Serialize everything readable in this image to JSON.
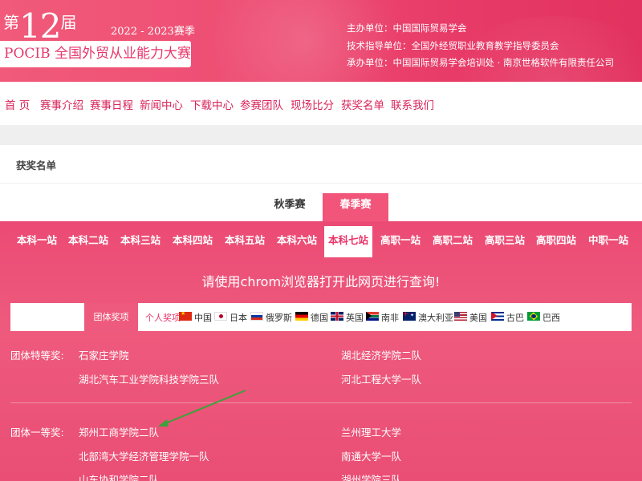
{
  "header": {
    "edition_prefix": "第",
    "edition_number": "12",
    "edition_suffix": "届",
    "season": "2022 - 2023赛季",
    "competition_title": "POCIB 全国外贸从业能力大赛",
    "organizers": [
      "主办单位：中国国际贸易学会",
      "技术指导单位：全国外经贸职业教育教学指导委员会",
      "承办单位：中国国际贸易学会培训处 · 南京世格软件有限责任公司"
    ]
  },
  "nav": {
    "items": [
      "首 页",
      "赛事介绍",
      "赛事日程",
      "新闻中心",
      "下载中心",
      "参赛团队",
      "现场比分",
      "获奖名单",
      "联系我们"
    ]
  },
  "breadcrumb": "获奖名单",
  "season_tabs": {
    "items": [
      "秋季赛",
      "春季赛"
    ],
    "active": "春季赛"
  },
  "stations": {
    "items": [
      "本科一站",
      "本科二站",
      "本科三站",
      "本科四站",
      "本科五站",
      "本科六站",
      "本科七站",
      "高职一站",
      "高职二站",
      "高职三站",
      "高职四站",
      "中职一站"
    ],
    "active": "本科七站"
  },
  "notice": "请使用chrom浏览器打开此网页进行查询!",
  "filter": {
    "team_label": "团体奖项",
    "individual_label": "个人奖项:",
    "countries": [
      {
        "name": "中国",
        "flag": "cn-flag-icon"
      },
      {
        "name": "日本",
        "flag": "jp-flag-icon"
      },
      {
        "name": "俄罗斯",
        "flag": "ru-flag-icon"
      },
      {
        "name": "德国",
        "flag": "de-flag-icon"
      },
      {
        "name": "英国",
        "flag": "gb-flag-icon"
      },
      {
        "name": "南非",
        "flag": "za-flag-icon"
      },
      {
        "name": "澳大利亚",
        "flag": "au-flag-icon"
      },
      {
        "name": "美国",
        "flag": "us-flag-icon"
      },
      {
        "name": "古巴",
        "flag": "cu-flag-icon"
      },
      {
        "name": "巴西",
        "flag": "br-flag-icon"
      }
    ]
  },
  "awards": {
    "special": {
      "label": "团体特等奖:",
      "left": [
        "石家庄学院",
        "湖北汽车工业学院科技学院三队"
      ],
      "right": [
        "湖北经济学院二队",
        "河北工程大学一队"
      ]
    },
    "first": {
      "label": "团体一等奖:",
      "left": [
        "郑州工商学院二队",
        "北部湾大学经济管理学院一队",
        "山东协和学院二队"
      ],
      "right": [
        "兰州理工大学",
        "南通大学一队",
        "湖州学院三队"
      ]
    }
  },
  "colors": {
    "brand_pink": "#ee5a7d",
    "accent_red": "#d8245a",
    "annotation_arrow": "#3aa33a"
  }
}
